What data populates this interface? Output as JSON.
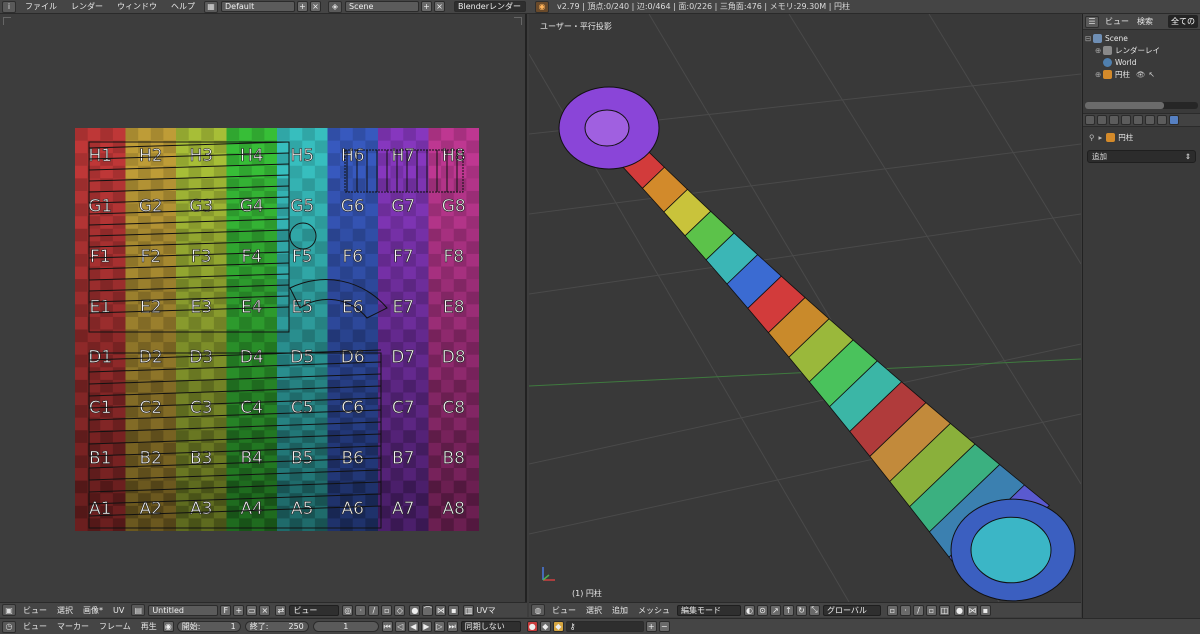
{
  "topbar": {
    "menus": [
      "ファイル",
      "レンダー",
      "ウィンドウ",
      "ヘルプ"
    ],
    "layout_name": "Default",
    "scene_name": "Scene",
    "render_engine": "Blenderレンダー",
    "stats": "v2.79 | 頂点:0/240 | 辺:0/464 | 面:0/226 | 三角面:476 | メモリ:29.30M | 円柱"
  },
  "uv_image": {
    "cols": 8,
    "rows": 8,
    "row_letters": [
      "H",
      "G",
      "F",
      "E",
      "D",
      "C",
      "B",
      "A"
    ],
    "col_hues": [
      0,
      45,
      70,
      120,
      180,
      225,
      275,
      320
    ]
  },
  "uv_header": {
    "menus": [
      "ビュー",
      "選択",
      "画像*",
      "UV"
    ],
    "image_name": "Untitled",
    "f_label": "F",
    "view_dd": "ビュー",
    "uvmap_label": "UVマ"
  },
  "viewport": {
    "view_label": "ユーザー・平行投影",
    "object_label": "(1) 円柱"
  },
  "viewport_header": {
    "menus": [
      "ビュー",
      "選択",
      "追加",
      "メッシュ"
    ],
    "mode": "編集モード",
    "orientation": "グローバル"
  },
  "outliner": {
    "menus": [
      "ビュー",
      "検索"
    ],
    "filter": "全ての",
    "items": [
      "Scene",
      "レンダーレイ",
      "World",
      "円柱"
    ]
  },
  "properties": {
    "object_name": "円柱",
    "add_dropdown": "追加"
  },
  "timeline": {
    "menus": [
      "ビュー",
      "マーカー",
      "フレーム",
      "再生"
    ],
    "start_label": "開始:",
    "start_value": "1",
    "end_label": "終了:",
    "end_value": "250",
    "current_frame": "1",
    "sync": "同期しない"
  }
}
